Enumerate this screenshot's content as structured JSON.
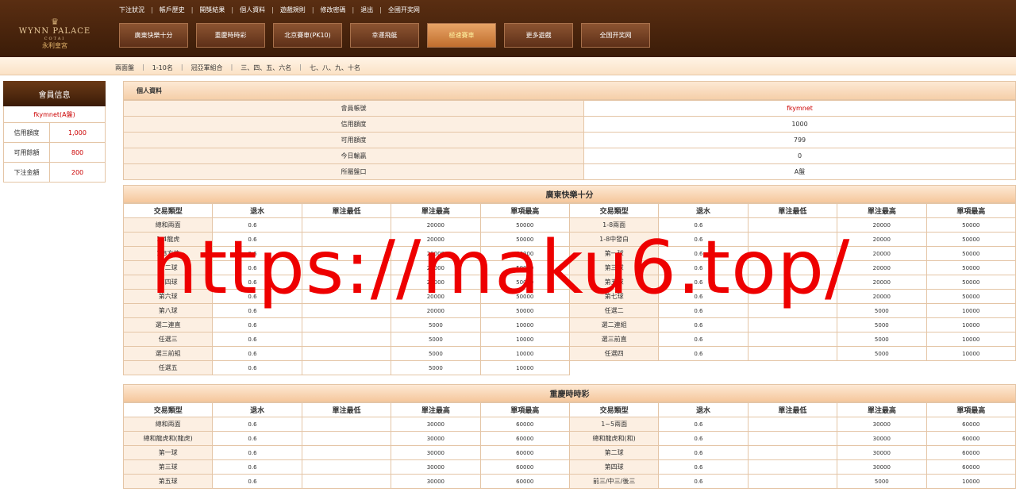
{
  "top_links": [
    "下注狀況",
    "帳戶歷史",
    "開獎結果",
    "個人資料",
    "遊戲規則",
    "修改密碼",
    "退出",
    "全國开奖网"
  ],
  "logo": {
    "crest": "♛",
    "line1": "WYNN PALACE",
    "line2": "COTAI",
    "line3": "永利皇宮"
  },
  "games_nav": [
    {
      "label": "廣東快樂十分",
      "active": false
    },
    {
      "label": "重慶時時彩",
      "active": false
    },
    {
      "label": "北京賽車(PK10)",
      "active": false
    },
    {
      "label": "幸運飛艇",
      "active": false
    },
    {
      "label": "極速賽車",
      "active": true
    },
    {
      "label": "更多遊戲",
      "active": false
    },
    {
      "label": "全国开奖网",
      "active": false
    }
  ],
  "sub_nav": [
    "兩面盤",
    "1-10名",
    "冠亞軍組合",
    "三、四、五、六名",
    "七、八、九、十名"
  ],
  "sidebar": {
    "title": "會員信息",
    "account": "fkymnet(A盤)",
    "rows": [
      {
        "label": "信用額度",
        "value": "1,000"
      },
      {
        "label": "可用餘額",
        "value": "800"
      },
      {
        "label": "下注金額",
        "value": "200"
      }
    ]
  },
  "profile": {
    "title": "個人資料",
    "rows": [
      {
        "label": "會員帳號",
        "value": "fkymnet"
      },
      {
        "label": "信用額度",
        "value": "1000"
      },
      {
        "label": "可用額度",
        "value": "799"
      },
      {
        "label": "今日輸贏",
        "value": "0"
      },
      {
        "label": "所屬盤口",
        "value": "A盤"
      }
    ]
  },
  "columns": [
    "交易類型",
    "退水",
    "單注最低",
    "單注最高",
    "單項最高",
    "交易類型",
    "退水",
    "單注最低",
    "單注最高",
    "單項最高"
  ],
  "tables": [
    {
      "title": "廣東快樂十分",
      "rows": [
        [
          "總和兩面",
          "0.6",
          "",
          "20000",
          "50000",
          "1-8兩面",
          "0.6",
          "",
          "20000",
          "50000"
        ],
        [
          "1-4龍虎",
          "0.6",
          "",
          "20000",
          "50000",
          "1-8中發白",
          "0.6",
          "",
          "20000",
          "50000"
        ],
        [
          "1-8方位",
          "0.6",
          "",
          "20000",
          "50000",
          "第一球",
          "0.6",
          "",
          "20000",
          "50000"
        ],
        [
          "第二球",
          "0.6",
          "",
          "20000",
          "50000",
          "第三球",
          "0.6",
          "",
          "20000",
          "50000"
        ],
        [
          "第四球",
          "0.6",
          "",
          "20000",
          "50000",
          "第五球",
          "0.6",
          "",
          "20000",
          "50000"
        ],
        [
          "第六球",
          "0.6",
          "",
          "20000",
          "50000",
          "第七球",
          "0.6",
          "",
          "20000",
          "50000"
        ],
        [
          "第八球",
          "0.6",
          "",
          "20000",
          "50000",
          "任選二",
          "0.6",
          "",
          "5000",
          "10000"
        ],
        [
          "選二連直",
          "0.6",
          "",
          "5000",
          "10000",
          "選二連組",
          "0.6",
          "",
          "5000",
          "10000"
        ],
        [
          "任選三",
          "0.6",
          "",
          "5000",
          "10000",
          "選三前直",
          "0.6",
          "",
          "5000",
          "10000"
        ],
        [
          "選三前組",
          "0.6",
          "",
          "5000",
          "10000",
          "任選四",
          "0.6",
          "",
          "5000",
          "10000"
        ],
        [
          "任選五",
          "0.6",
          "",
          "5000",
          "10000"
        ]
      ]
    },
    {
      "title": "重慶時時彩",
      "rows": [
        [
          "總和兩面",
          "0.6",
          "",
          "30000",
          "60000",
          "1~5兩面",
          "0.6",
          "",
          "30000",
          "60000"
        ],
        [
          "總和龍虎和(龍虎)",
          "0.6",
          "",
          "30000",
          "60000",
          "總和龍虎和(和)",
          "0.6",
          "",
          "30000",
          "60000"
        ],
        [
          "第一球",
          "0.6",
          "",
          "30000",
          "60000",
          "第二球",
          "0.6",
          "",
          "30000",
          "60000"
        ],
        [
          "第三球",
          "0.6",
          "",
          "30000",
          "60000",
          "第四球",
          "0.6",
          "",
          "30000",
          "60000"
        ],
        [
          "第五球",
          "0.6",
          "",
          "30000",
          "60000",
          "前三/中三/後三",
          "0.6",
          "",
          "5000",
          "10000"
        ]
      ]
    }
  ],
  "watermark": "https://maku6.top/"
}
